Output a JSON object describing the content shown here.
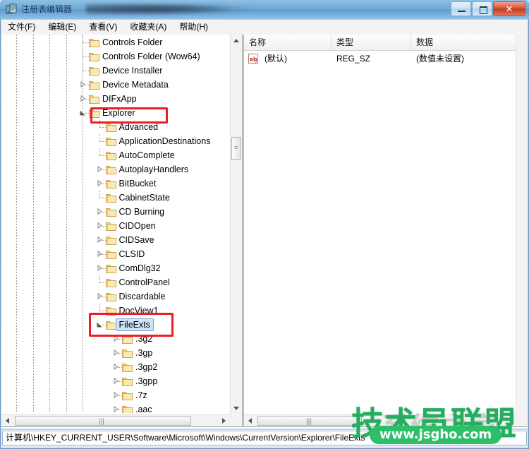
{
  "window": {
    "title": "注册表编辑器",
    "icon": "registry-editor-icon",
    "buttons": {
      "minimize": "minimize-button",
      "maximize": "maximize-button",
      "close": "✕"
    }
  },
  "menu": {
    "items": [
      {
        "label": "文件(F)",
        "name": "menu-file"
      },
      {
        "label": "编辑(E)",
        "name": "menu-edit"
      },
      {
        "label": "查看(V)",
        "name": "menu-view"
      },
      {
        "label": "收藏夹(A)",
        "name": "menu-favorites"
      },
      {
        "label": "帮助(H)",
        "name": "menu-help"
      }
    ]
  },
  "tree": {
    "nodes": [
      {
        "label": "Controls Folder",
        "depth": 5,
        "twisty": "none",
        "selected": false
      },
      {
        "label": "Controls Folder (Wow64)",
        "depth": 5,
        "twisty": "none",
        "selected": false
      },
      {
        "label": "Device Installer",
        "depth": 5,
        "twisty": "none",
        "selected": false
      },
      {
        "label": "Device Metadata",
        "depth": 5,
        "twisty": "collapsed",
        "selected": false
      },
      {
        "label": "DIFxApp",
        "depth": 5,
        "twisty": "collapsed",
        "selected": false
      },
      {
        "label": "Explorer",
        "depth": 5,
        "twisty": "expanded",
        "selected": false
      },
      {
        "label": "Advanced",
        "depth": 6,
        "twisty": "none",
        "selected": false
      },
      {
        "label": "ApplicationDestinations",
        "depth": 6,
        "twisty": "none",
        "selected": false
      },
      {
        "label": "AutoComplete",
        "depth": 6,
        "twisty": "none",
        "selected": false
      },
      {
        "label": "AutoplayHandlers",
        "depth": 6,
        "twisty": "collapsed",
        "selected": false
      },
      {
        "label": "BitBucket",
        "depth": 6,
        "twisty": "collapsed",
        "selected": false
      },
      {
        "label": "CabinetState",
        "depth": 6,
        "twisty": "none",
        "selected": false
      },
      {
        "label": "CD Burning",
        "depth": 6,
        "twisty": "collapsed",
        "selected": false
      },
      {
        "label": "CIDOpen",
        "depth": 6,
        "twisty": "collapsed",
        "selected": false
      },
      {
        "label": "CIDSave",
        "depth": 6,
        "twisty": "collapsed",
        "selected": false
      },
      {
        "label": "CLSID",
        "depth": 6,
        "twisty": "collapsed",
        "selected": false
      },
      {
        "label": "ComDlg32",
        "depth": 6,
        "twisty": "collapsed",
        "selected": false
      },
      {
        "label": "ControlPanel",
        "depth": 6,
        "twisty": "none",
        "selected": false
      },
      {
        "label": "Discardable",
        "depth": 6,
        "twisty": "collapsed",
        "selected": false
      },
      {
        "label": "DocView1",
        "depth": 6,
        "twisty": "none",
        "selected": false
      },
      {
        "label": "FileExts",
        "depth": 6,
        "twisty": "expanded",
        "selected": true
      },
      {
        "label": ".3g2",
        "depth": 7,
        "twisty": "collapsed",
        "selected": false
      },
      {
        "label": ".3gp",
        "depth": 7,
        "twisty": "collapsed",
        "selected": false
      },
      {
        "label": ".3gp2",
        "depth": 7,
        "twisty": "collapsed",
        "selected": false
      },
      {
        "label": ".3gpp",
        "depth": 7,
        "twisty": "collapsed",
        "selected": false
      },
      {
        "label": ".7z",
        "depth": 7,
        "twisty": "collapsed",
        "selected": false
      },
      {
        "label": ".aac",
        "depth": 7,
        "twisty": "collapsed",
        "selected": false
      }
    ]
  },
  "list": {
    "columns": [
      "名称",
      "类型",
      "数据"
    ],
    "rows": [
      {
        "name": "(默认)",
        "type": "REG_SZ",
        "data": "(数值未设置)",
        "icon": "string-value-icon"
      }
    ]
  },
  "status": {
    "path": "计算机\\HKEY_CURRENT_USER\\Software\\Microsoft\\Windows\\CurrentVersion\\Explorer\\FileExts"
  },
  "annotations": [
    {
      "name": "highlight-explorer",
      "color": "#ee1c25"
    },
    {
      "name": "highlight-fileexts",
      "color": "#ee1c25"
    }
  ],
  "watermark": {
    "brand": "技术员联盟",
    "url": "www.jsgho.com",
    "background": "系统之家"
  }
}
